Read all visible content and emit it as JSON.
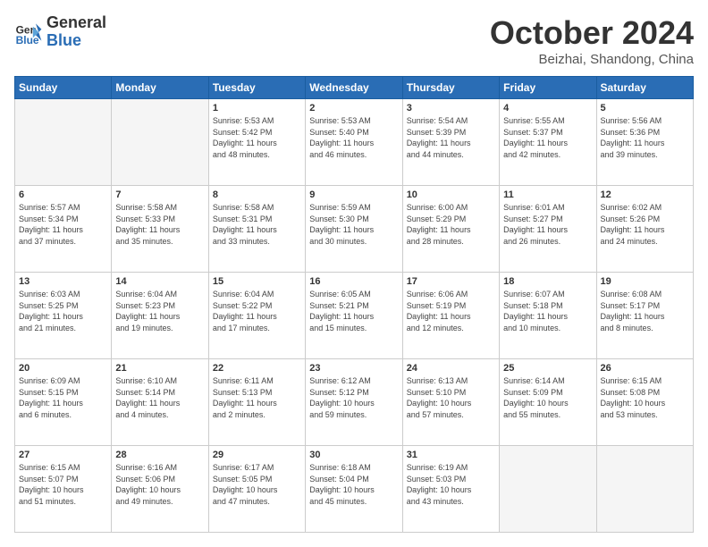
{
  "logo": {
    "general": "General",
    "blue": "Blue"
  },
  "title": "October 2024",
  "location": "Beizhai, Shandong, China",
  "days_of_week": [
    "Sunday",
    "Monday",
    "Tuesday",
    "Wednesday",
    "Thursday",
    "Friday",
    "Saturday"
  ],
  "weeks": [
    [
      {
        "day": "",
        "empty": true
      },
      {
        "day": "",
        "empty": true
      },
      {
        "day": "1",
        "line1": "Sunrise: 5:53 AM",
        "line2": "Sunset: 5:42 PM",
        "line3": "Daylight: 11 hours",
        "line4": "and 48 minutes."
      },
      {
        "day": "2",
        "line1": "Sunrise: 5:53 AM",
        "line2": "Sunset: 5:40 PM",
        "line3": "Daylight: 11 hours",
        "line4": "and 46 minutes."
      },
      {
        "day": "3",
        "line1": "Sunrise: 5:54 AM",
        "line2": "Sunset: 5:39 PM",
        "line3": "Daylight: 11 hours",
        "line4": "and 44 minutes."
      },
      {
        "day": "4",
        "line1": "Sunrise: 5:55 AM",
        "line2": "Sunset: 5:37 PM",
        "line3": "Daylight: 11 hours",
        "line4": "and 42 minutes."
      },
      {
        "day": "5",
        "line1": "Sunrise: 5:56 AM",
        "line2": "Sunset: 5:36 PM",
        "line3": "Daylight: 11 hours",
        "line4": "and 39 minutes."
      }
    ],
    [
      {
        "day": "6",
        "line1": "Sunrise: 5:57 AM",
        "line2": "Sunset: 5:34 PM",
        "line3": "Daylight: 11 hours",
        "line4": "and 37 minutes."
      },
      {
        "day": "7",
        "line1": "Sunrise: 5:58 AM",
        "line2": "Sunset: 5:33 PM",
        "line3": "Daylight: 11 hours",
        "line4": "and 35 minutes."
      },
      {
        "day": "8",
        "line1": "Sunrise: 5:58 AM",
        "line2": "Sunset: 5:31 PM",
        "line3": "Daylight: 11 hours",
        "line4": "and 33 minutes."
      },
      {
        "day": "9",
        "line1": "Sunrise: 5:59 AM",
        "line2": "Sunset: 5:30 PM",
        "line3": "Daylight: 11 hours",
        "line4": "and 30 minutes."
      },
      {
        "day": "10",
        "line1": "Sunrise: 6:00 AM",
        "line2": "Sunset: 5:29 PM",
        "line3": "Daylight: 11 hours",
        "line4": "and 28 minutes."
      },
      {
        "day": "11",
        "line1": "Sunrise: 6:01 AM",
        "line2": "Sunset: 5:27 PM",
        "line3": "Daylight: 11 hours",
        "line4": "and 26 minutes."
      },
      {
        "day": "12",
        "line1": "Sunrise: 6:02 AM",
        "line2": "Sunset: 5:26 PM",
        "line3": "Daylight: 11 hours",
        "line4": "and 24 minutes."
      }
    ],
    [
      {
        "day": "13",
        "line1": "Sunrise: 6:03 AM",
        "line2": "Sunset: 5:25 PM",
        "line3": "Daylight: 11 hours",
        "line4": "and 21 minutes."
      },
      {
        "day": "14",
        "line1": "Sunrise: 6:04 AM",
        "line2": "Sunset: 5:23 PM",
        "line3": "Daylight: 11 hours",
        "line4": "and 19 minutes."
      },
      {
        "day": "15",
        "line1": "Sunrise: 6:04 AM",
        "line2": "Sunset: 5:22 PM",
        "line3": "Daylight: 11 hours",
        "line4": "and 17 minutes."
      },
      {
        "day": "16",
        "line1": "Sunrise: 6:05 AM",
        "line2": "Sunset: 5:21 PM",
        "line3": "Daylight: 11 hours",
        "line4": "and 15 minutes."
      },
      {
        "day": "17",
        "line1": "Sunrise: 6:06 AM",
        "line2": "Sunset: 5:19 PM",
        "line3": "Daylight: 11 hours",
        "line4": "and 12 minutes."
      },
      {
        "day": "18",
        "line1": "Sunrise: 6:07 AM",
        "line2": "Sunset: 5:18 PM",
        "line3": "Daylight: 11 hours",
        "line4": "and 10 minutes."
      },
      {
        "day": "19",
        "line1": "Sunrise: 6:08 AM",
        "line2": "Sunset: 5:17 PM",
        "line3": "Daylight: 11 hours",
        "line4": "and 8 minutes."
      }
    ],
    [
      {
        "day": "20",
        "line1": "Sunrise: 6:09 AM",
        "line2": "Sunset: 5:15 PM",
        "line3": "Daylight: 11 hours",
        "line4": "and 6 minutes."
      },
      {
        "day": "21",
        "line1": "Sunrise: 6:10 AM",
        "line2": "Sunset: 5:14 PM",
        "line3": "Daylight: 11 hours",
        "line4": "and 4 minutes."
      },
      {
        "day": "22",
        "line1": "Sunrise: 6:11 AM",
        "line2": "Sunset: 5:13 PM",
        "line3": "Daylight: 11 hours",
        "line4": "and 2 minutes."
      },
      {
        "day": "23",
        "line1": "Sunrise: 6:12 AM",
        "line2": "Sunset: 5:12 PM",
        "line3": "Daylight: 10 hours",
        "line4": "and 59 minutes."
      },
      {
        "day": "24",
        "line1": "Sunrise: 6:13 AM",
        "line2": "Sunset: 5:10 PM",
        "line3": "Daylight: 10 hours",
        "line4": "and 57 minutes."
      },
      {
        "day": "25",
        "line1": "Sunrise: 6:14 AM",
        "line2": "Sunset: 5:09 PM",
        "line3": "Daylight: 10 hours",
        "line4": "and 55 minutes."
      },
      {
        "day": "26",
        "line1": "Sunrise: 6:15 AM",
        "line2": "Sunset: 5:08 PM",
        "line3": "Daylight: 10 hours",
        "line4": "and 53 minutes."
      }
    ],
    [
      {
        "day": "27",
        "line1": "Sunrise: 6:15 AM",
        "line2": "Sunset: 5:07 PM",
        "line3": "Daylight: 10 hours",
        "line4": "and 51 minutes."
      },
      {
        "day": "28",
        "line1": "Sunrise: 6:16 AM",
        "line2": "Sunset: 5:06 PM",
        "line3": "Daylight: 10 hours",
        "line4": "and 49 minutes."
      },
      {
        "day": "29",
        "line1": "Sunrise: 6:17 AM",
        "line2": "Sunset: 5:05 PM",
        "line3": "Daylight: 10 hours",
        "line4": "and 47 minutes."
      },
      {
        "day": "30",
        "line1": "Sunrise: 6:18 AM",
        "line2": "Sunset: 5:04 PM",
        "line3": "Daylight: 10 hours",
        "line4": "and 45 minutes."
      },
      {
        "day": "31",
        "line1": "Sunrise: 6:19 AM",
        "line2": "Sunset: 5:03 PM",
        "line3": "Daylight: 10 hours",
        "line4": "and 43 minutes."
      },
      {
        "day": "",
        "empty": true
      },
      {
        "day": "",
        "empty": true
      }
    ]
  ]
}
